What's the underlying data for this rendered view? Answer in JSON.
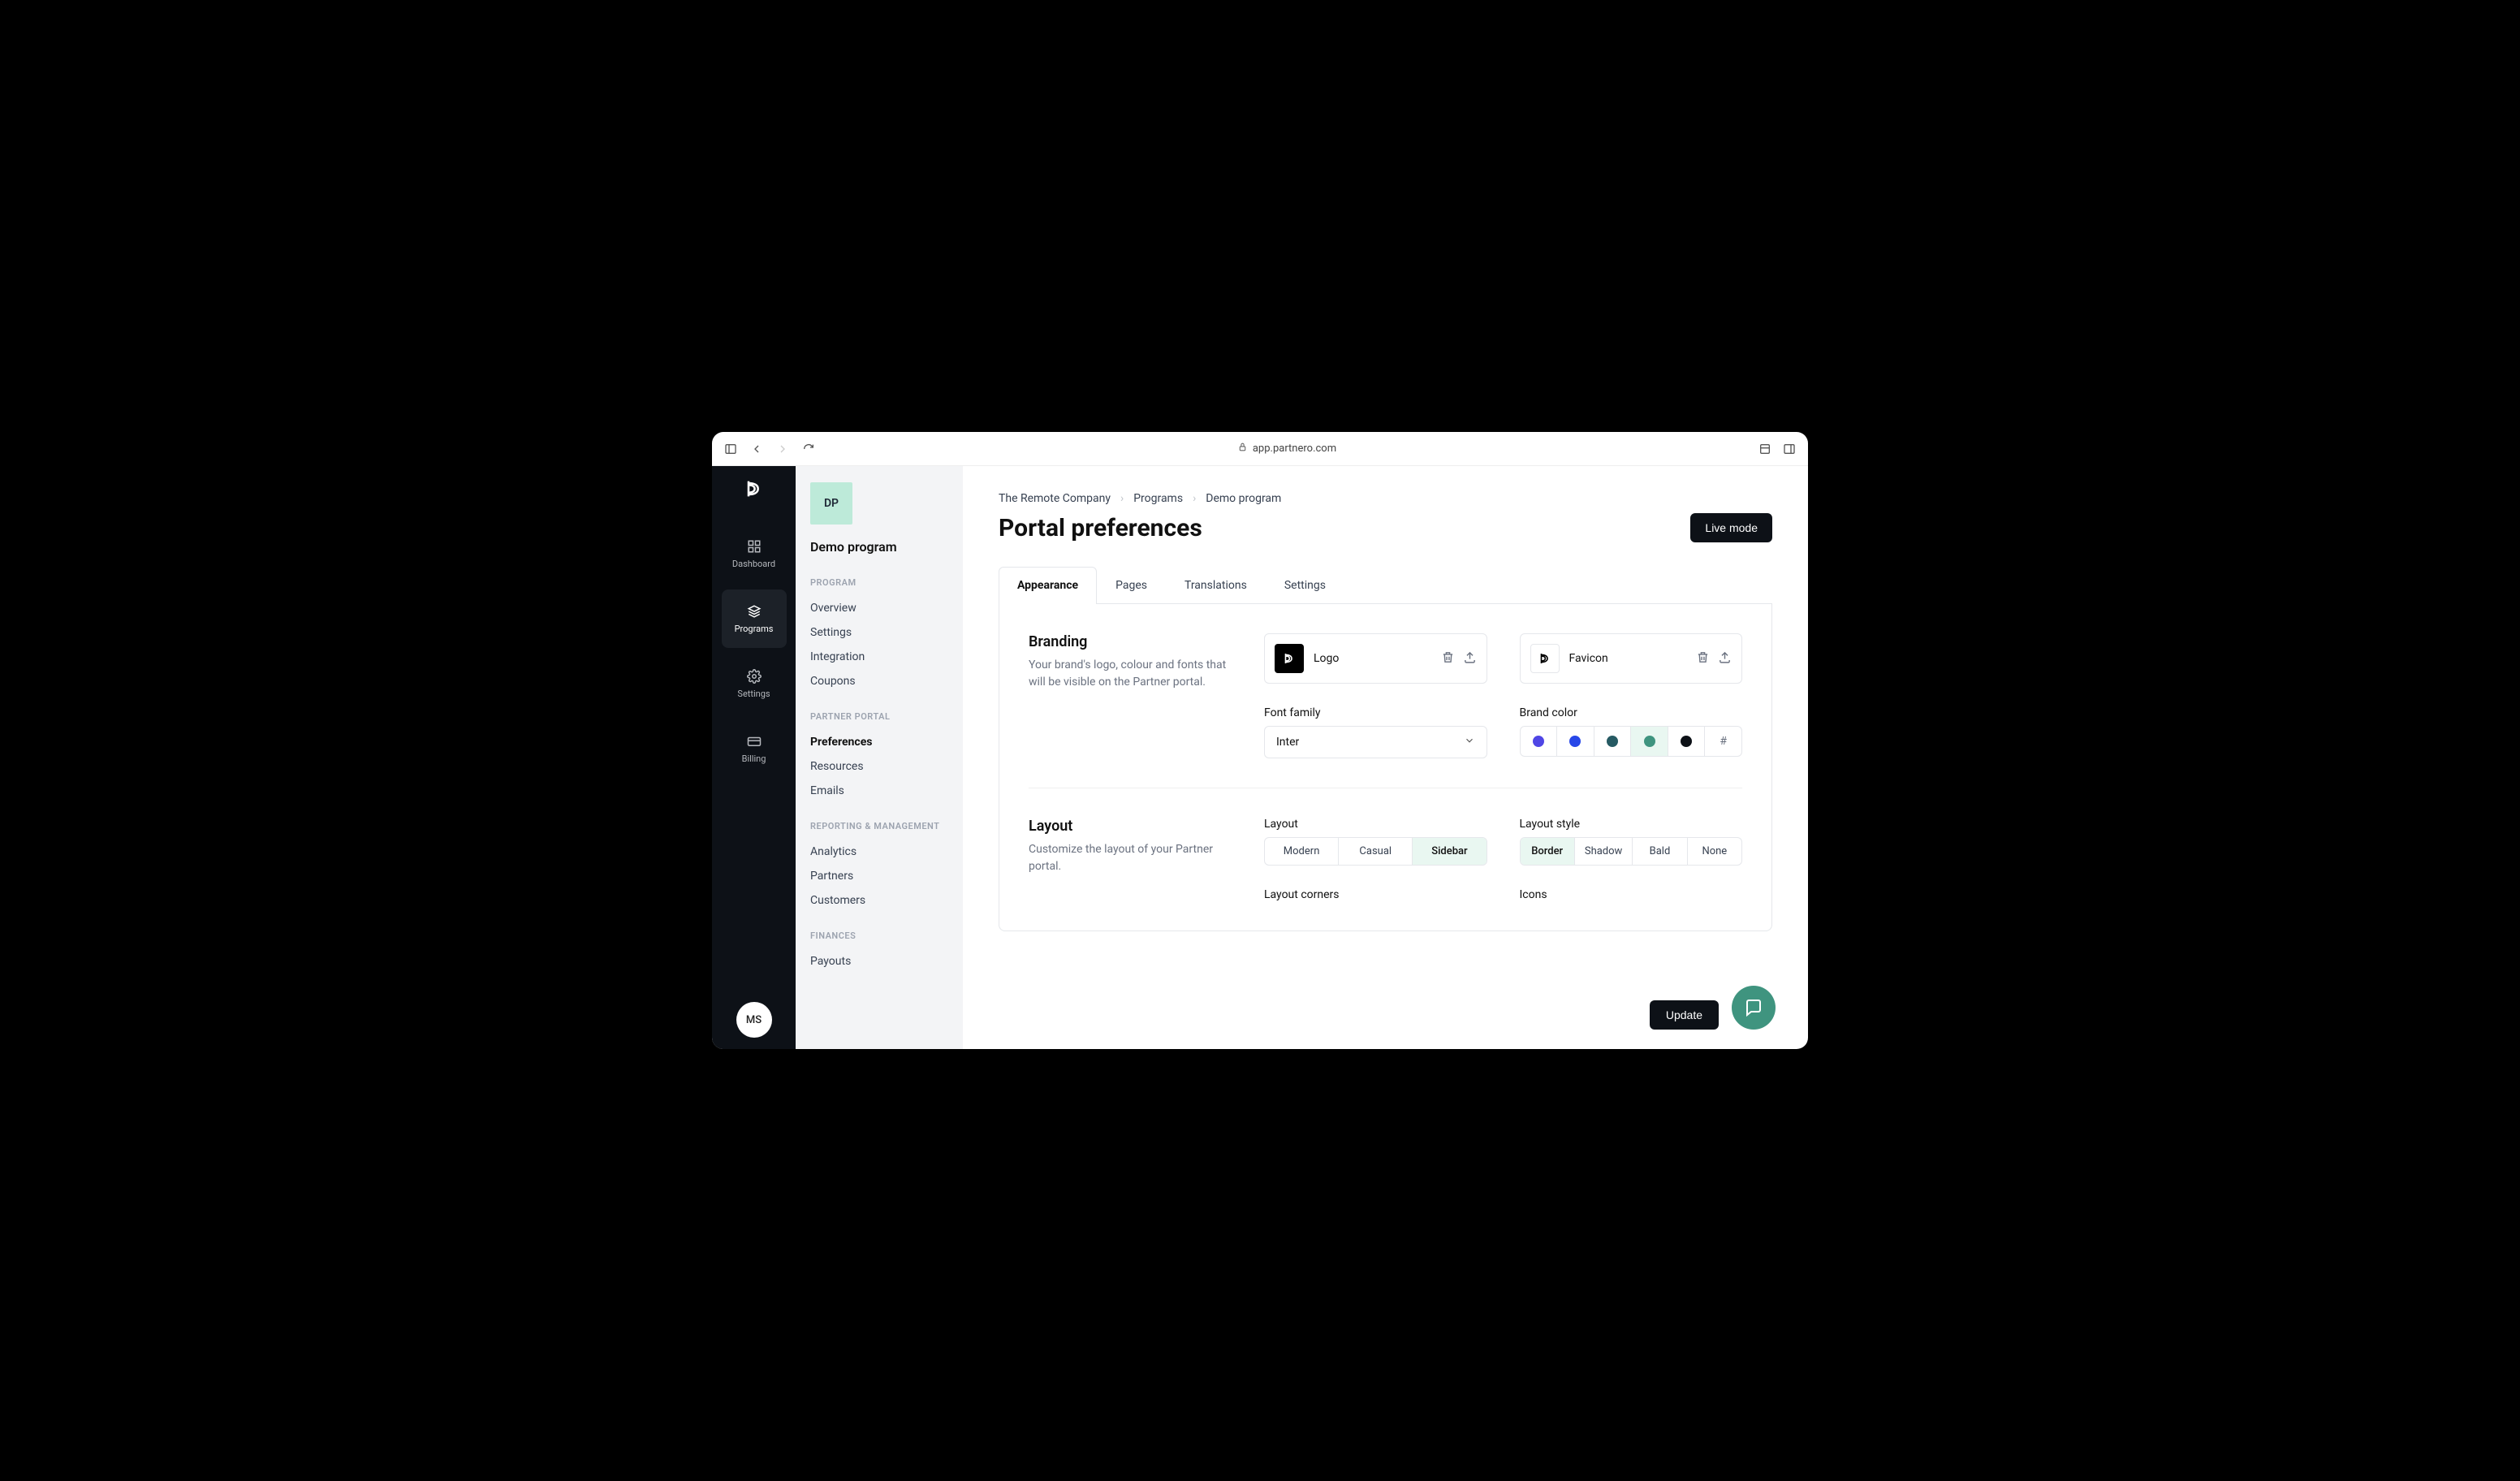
{
  "browser": {
    "url": "app.partnero.com"
  },
  "rail": {
    "items": [
      {
        "label": "Dashboard"
      },
      {
        "label": "Programs"
      },
      {
        "label": "Settings"
      },
      {
        "label": "Billing"
      }
    ],
    "avatar": "MS"
  },
  "sidebar": {
    "badge": "DP",
    "program_name": "Demo program",
    "sections": [
      {
        "label": "PROGRAM",
        "items": [
          "Overview",
          "Settings",
          "Integration",
          "Coupons"
        ]
      },
      {
        "label": "PARTNER PORTAL",
        "items": [
          "Preferences",
          "Resources",
          "Emails"
        ]
      },
      {
        "label": "REPORTING & MANAGEMENT",
        "items": [
          "Analytics",
          "Partners",
          "Customers"
        ]
      },
      {
        "label": "FINANCES",
        "items": [
          "Payouts"
        ]
      }
    ]
  },
  "breadcrumb": [
    "The Remote Company",
    "Programs",
    "Demo program"
  ],
  "page_title": "Portal preferences",
  "live_mode_label": "Live mode",
  "tabs": [
    "Appearance",
    "Pages",
    "Translations",
    "Settings"
  ],
  "branding": {
    "title": "Branding",
    "desc": "Your brand's logo, colour and fonts that will be visible on the Partner portal.",
    "logo_label": "Logo",
    "favicon_label": "Favicon",
    "font_label": "Font family",
    "font_value": "Inter",
    "brand_color_label": "Brand color",
    "colors": [
      "#4f46e5",
      "#2747e8",
      "#265a63",
      "#3f947f",
      "#0d1117"
    ],
    "selected_color_index": 3
  },
  "layout": {
    "title": "Layout",
    "desc": "Customize the layout of your Partner portal.",
    "layout_label": "Layout",
    "layout_options": [
      "Modern",
      "Casual",
      "Sidebar"
    ],
    "layout_selected": "Sidebar",
    "style_label": "Layout style",
    "style_options": [
      "Border",
      "Shadow",
      "Bald",
      "None"
    ],
    "style_selected": "Border",
    "corners_label": "Layout corners",
    "icons_label": "Icons"
  },
  "update_label": "Update"
}
